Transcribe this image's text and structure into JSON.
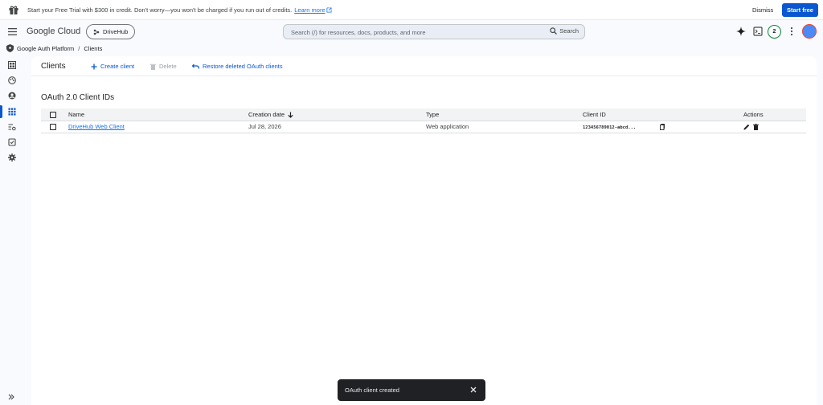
{
  "promo": {
    "message": "Start your Free Trial with $300 in credit. Don't worry—you won't be charged if you run out of credits.",
    "learn_more": "Learn more",
    "dismiss": "Dismiss",
    "start_free": "Start free"
  },
  "topbar": {
    "brand": "Google Cloud",
    "project": "DriveHub",
    "search_placeholder": "Search (/) for resources, docs, products, and more",
    "search_button": "Search",
    "notifications_count": "2"
  },
  "breadcrumb": {
    "product": "Google Auth Platform",
    "separator": "/",
    "page": "Clients"
  },
  "toolbar": {
    "title": "Clients",
    "create": "Create client",
    "delete": "Delete",
    "restore": "Restore deleted OAuth clients"
  },
  "section": {
    "title": "OAuth 2.0 Client IDs",
    "columns": [
      "Name",
      "Creation date",
      "Type",
      "Client ID",
      "Actions"
    ],
    "rows": [
      {
        "name": "DriveHub Web Client",
        "creation_date": "Jul 28, 2026",
        "type": "Web application",
        "client_id": "123456789012-abcd..."
      }
    ]
  },
  "snackbar": {
    "message": "OAuth client created"
  },
  "colors": {
    "accent": "#0b57d0",
    "link": "#1a73e8",
    "background": "#f8fafd"
  }
}
